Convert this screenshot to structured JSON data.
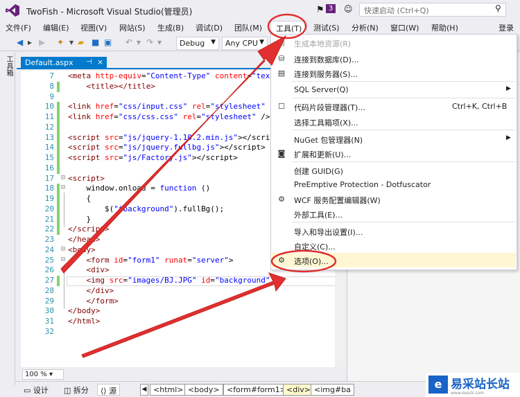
{
  "window": {
    "title": "TwoFish - Microsoft Visual Studio(管理员)",
    "notification_count": "3",
    "quick_launch_placeholder": "快速启动 (Ctrl+Q)",
    "login": "登录"
  },
  "menubar": {
    "items": [
      "文件(F)",
      "编辑(E)",
      "视图(V)",
      "网站(S)",
      "生成(B)",
      "调试(D)",
      "团队(M)",
      "工具(T)",
      "测试(S)",
      "分析(N)",
      "窗口(W)",
      "帮助(H)"
    ]
  },
  "toolbar": {
    "config": "Debug",
    "platform": "Any CPU"
  },
  "toolstrip": {
    "label": "工具箱"
  },
  "editor": {
    "tab_title": "Default.aspx",
    "zoom": "100 %",
    "line_numbers": [
      "7",
      "8",
      "9",
      "10",
      "11",
      "12",
      "13",
      "14",
      "15",
      "16",
      "17",
      "18",
      "19",
      "20",
      "21",
      "22",
      "23",
      "24",
      "25",
      "26",
      "27",
      "28",
      "29",
      "30",
      "31",
      "32"
    ]
  },
  "tools_menu": {
    "items": [
      {
        "label": "生成本地资源(R)",
        "shortcut": ""
      },
      {
        "label": "连接到数据库(D)...",
        "shortcut": ""
      },
      {
        "label": "连接到服务器(S)...",
        "shortcut": ""
      },
      {
        "label": "SQL Server(Q)",
        "shortcut": ""
      },
      {
        "label": "代码片段管理器(T)...",
        "shortcut": "Ctrl+K, Ctrl+B"
      },
      {
        "label": "选择工具箱项(X)...",
        "shortcut": ""
      },
      {
        "label": "NuGet 包管理器(N)",
        "shortcut": ""
      },
      {
        "label": "扩展和更新(U)...",
        "shortcut": ""
      },
      {
        "label": "创建 GUID(G)",
        "shortcut": ""
      },
      {
        "label": "PreEmptive Protection - Dotfuscator",
        "shortcut": ""
      },
      {
        "label": "WCF 服务配置编辑器(W)",
        "shortcut": ""
      },
      {
        "label": "外部工具(E)...",
        "shortcut": ""
      },
      {
        "label": "导入和导出设置(I)...",
        "shortcut": ""
      },
      {
        "label": "自定义(C)...",
        "shortcut": ""
      },
      {
        "label": "选项(O)...",
        "shortcut": ""
      }
    ]
  },
  "bottom_bar": {
    "design": "设计",
    "split": "拆分",
    "source": "源",
    "breadcrumbs": [
      "<html>",
      "<body>",
      "<form#form1>",
      "<div>",
      "<img#ba"
    ]
  },
  "watermark": {
    "text": "易采站长站",
    "sub": "www.easck.com"
  },
  "colors": {
    "accent": "#007acc",
    "vs_purple": "#68217a",
    "annotation_red": "#e03030"
  }
}
